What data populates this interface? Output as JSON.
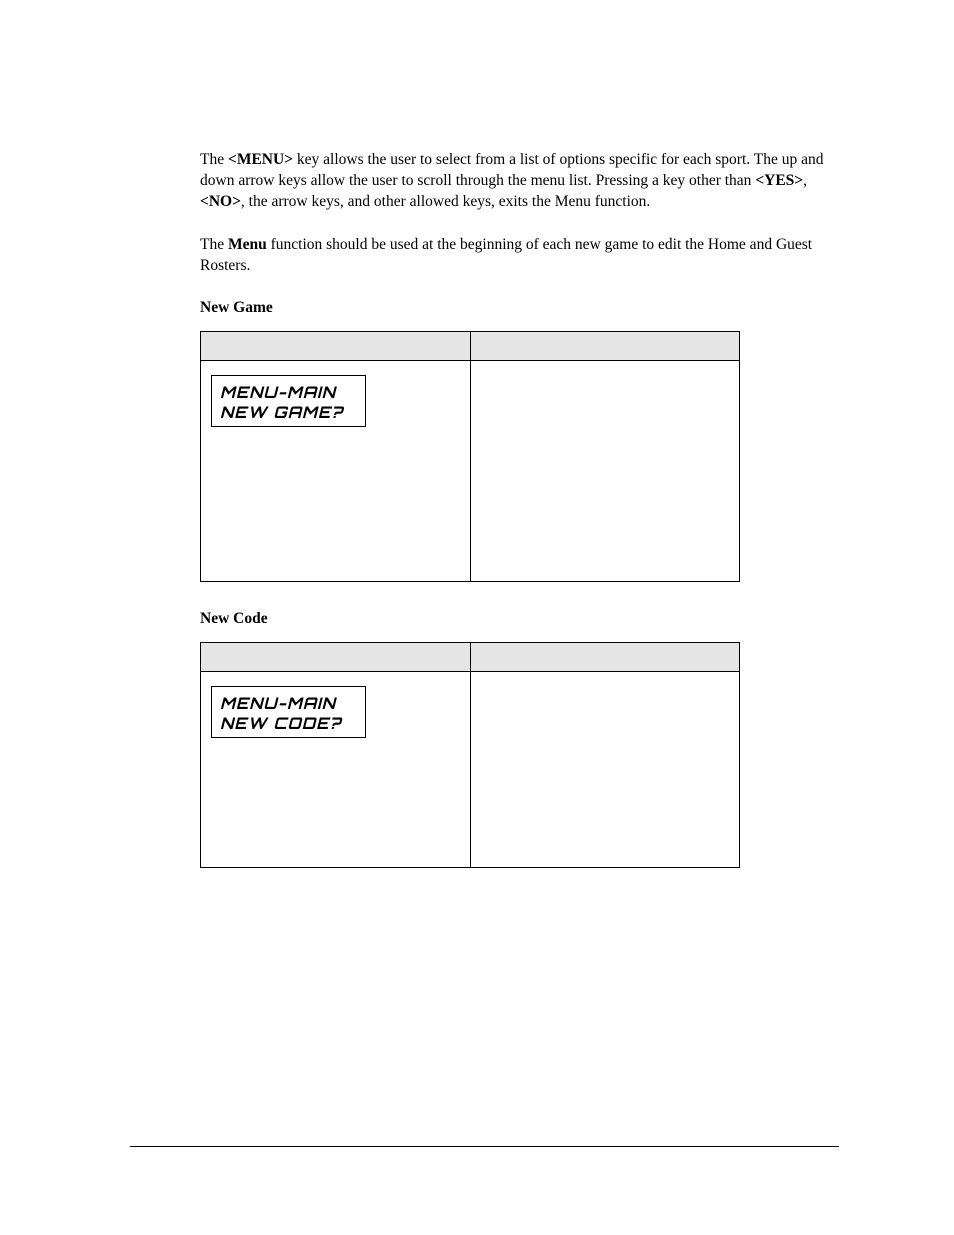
{
  "para1": {
    "t1": "The ",
    "k_menu": "<MENU>",
    "t2": " key allows the user to select from a list of options specific for each sport.  The up and down arrow keys allow the user to scroll through the menu list. Pressing a key other than ",
    "k_yes": "<YES>",
    "t3": ", ",
    "k_no": "<NO>",
    "t4": ", the arrow keys, and other allowed keys, exits the Menu function."
  },
  "para2": {
    "t1": "The ",
    "b_menu": "Menu",
    "t2": " function should be used at the beginning of each new game to edit the Home and Guest Rosters."
  },
  "section1": {
    "heading": "New Game",
    "lcd": {
      "line1": "MENU-MAIN",
      "line2": "NEW GAME?"
    }
  },
  "section2": {
    "heading": "New Code",
    "lcd": {
      "line1": "MENU-MAIN",
      "line2": "NEW CODE?"
    }
  }
}
